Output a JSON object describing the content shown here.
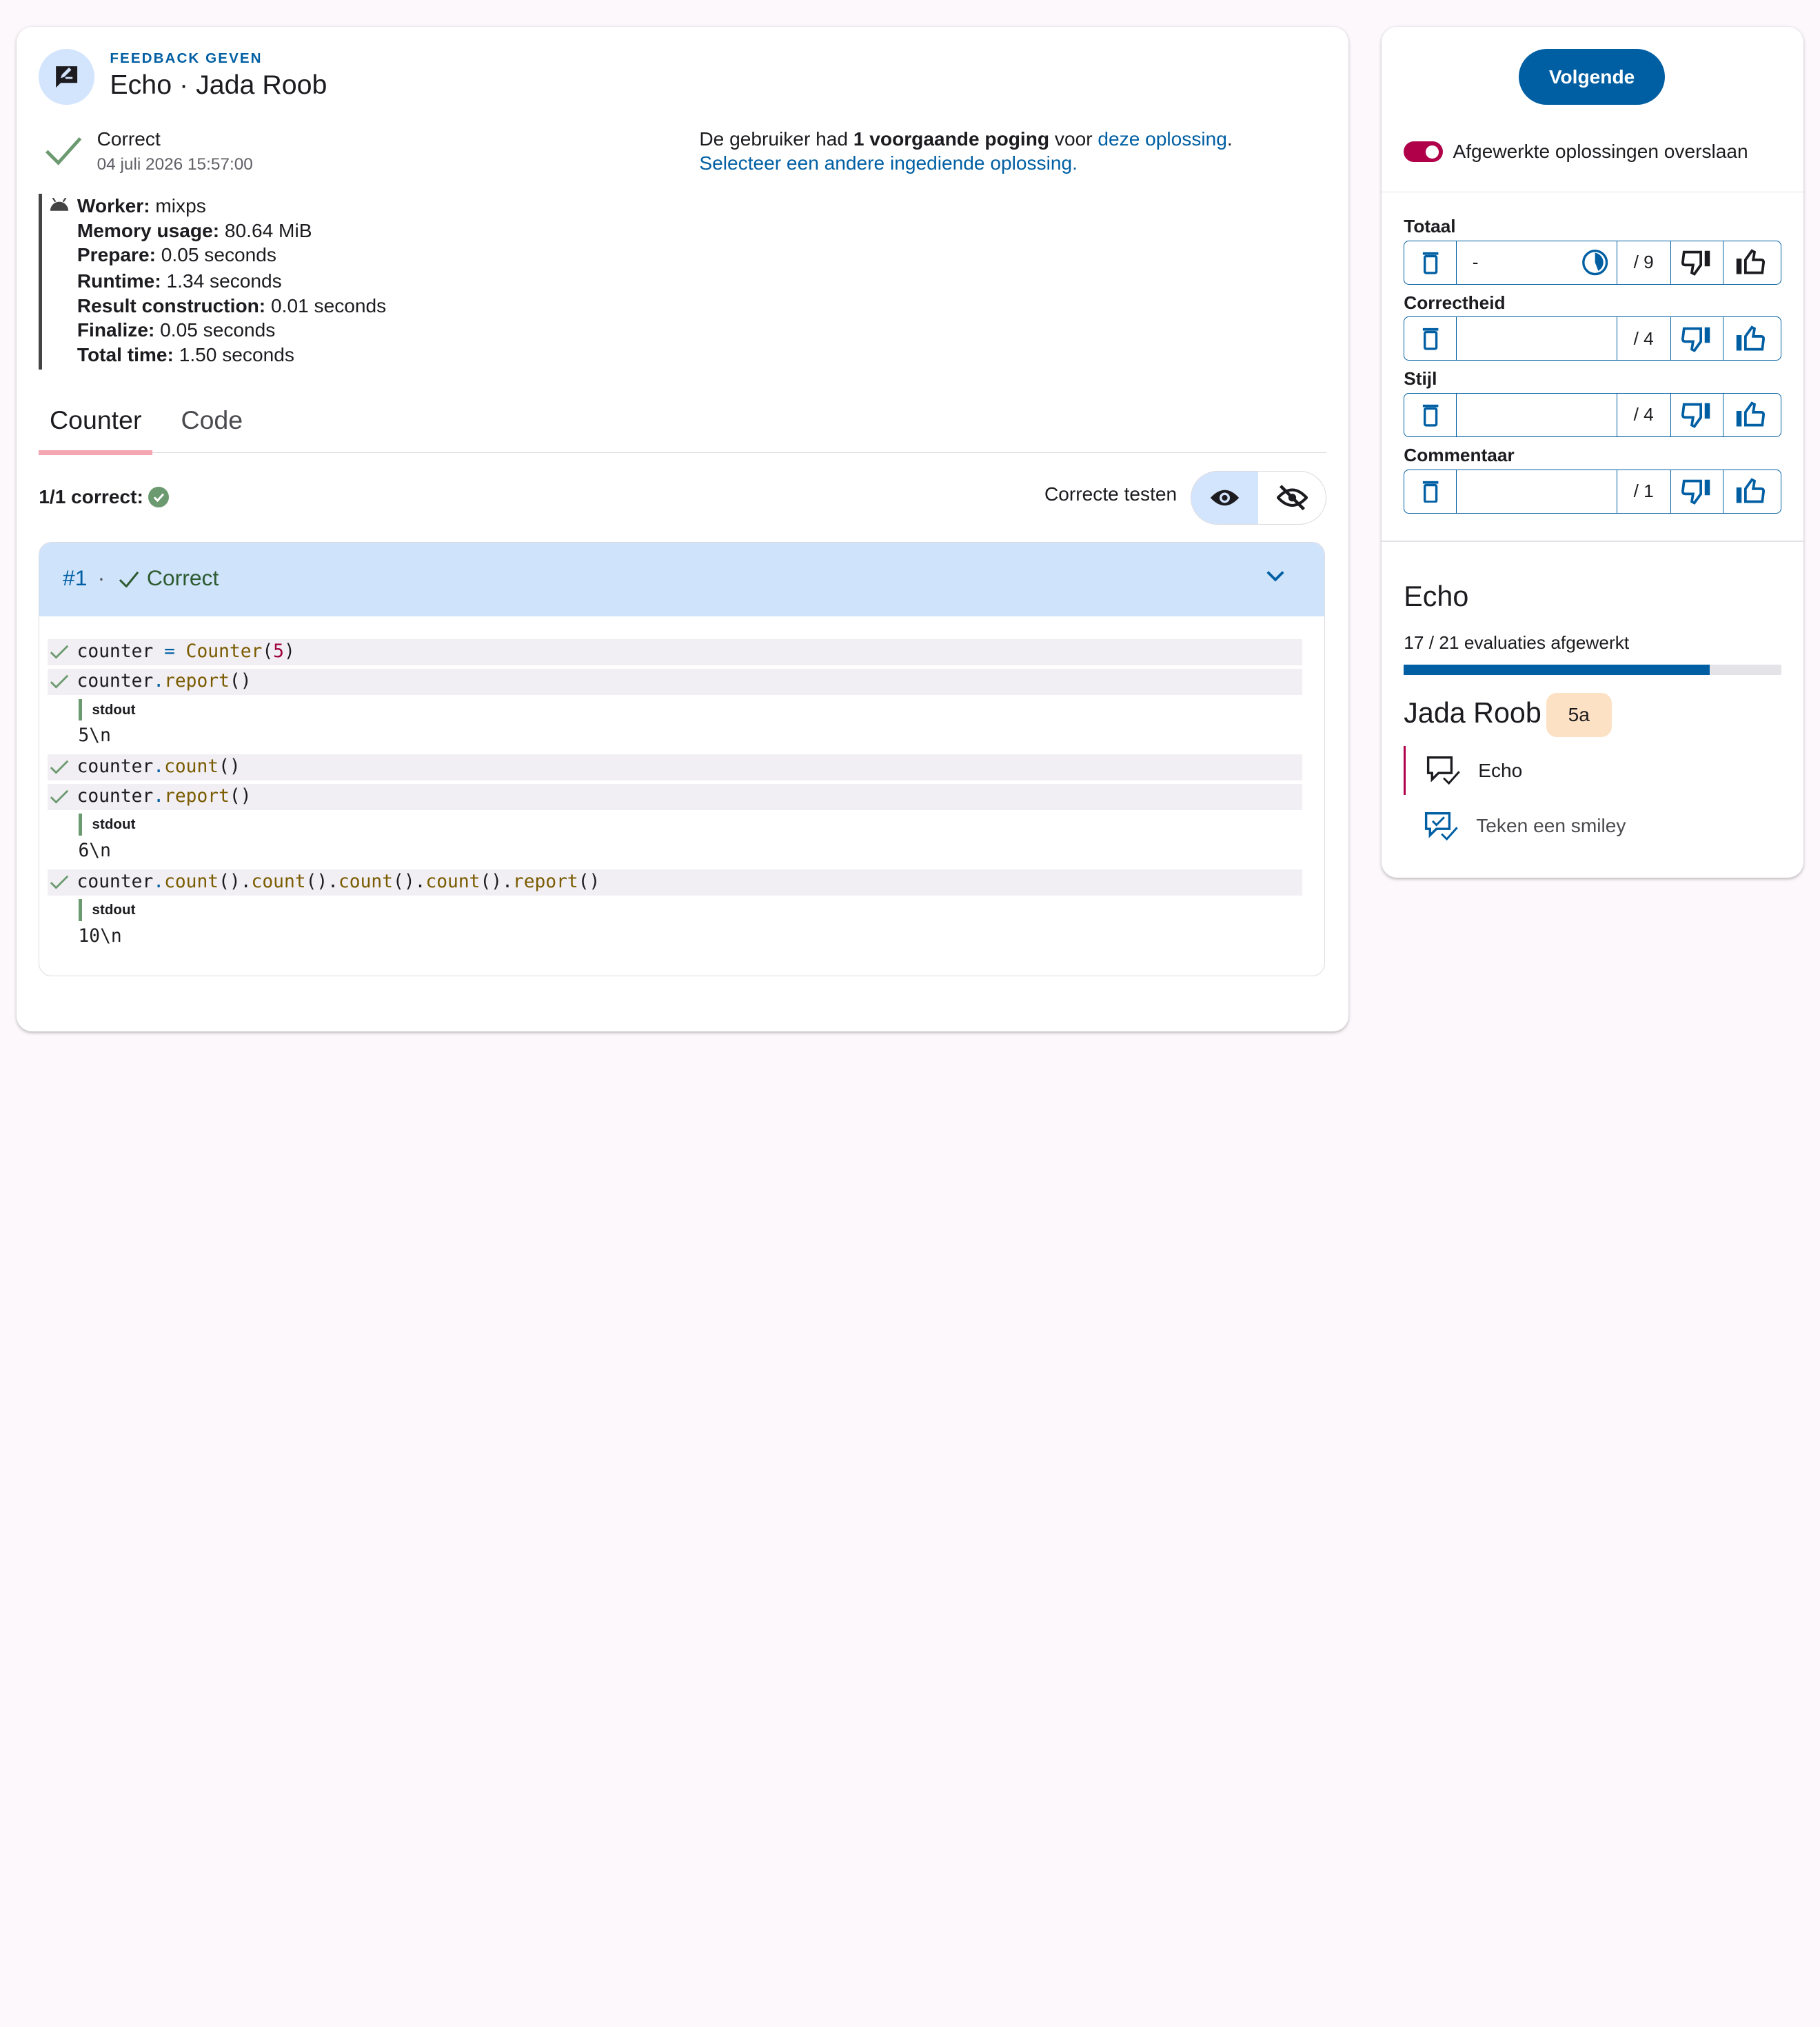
{
  "header": {
    "kicker": "FEEDBACK GEVEN",
    "title": "Echo · Jada Roob",
    "icon": "rate-review-icon"
  },
  "status": {
    "label": "Correct",
    "date": "04 juli 2026 15:57:00"
  },
  "previous": {
    "text_before": "De gebruiker had ",
    "bold": "1 voorgaande poging",
    "text_mid": " voor ",
    "link1": "deze oplossing",
    "text_end": ".",
    "link2": "Selecteer een andere ingediende oplossing."
  },
  "worker": [
    {
      "label": "Worker:",
      "value": " mixps"
    },
    {
      "label": "Memory usage:",
      "value": " 80.64 MiB"
    },
    {
      "label": "Prepare:",
      "value": " 0.05 seconds"
    },
    {
      "label": "Runtime:",
      "value": " 1.34 seconds"
    },
    {
      "label": "Result construction:",
      "value": " 0.01 seconds"
    },
    {
      "label": "Finalize:",
      "value": " 0.05 seconds"
    },
    {
      "label": "Total time:",
      "value": " 1.50 seconds"
    }
  ],
  "tabs": [
    "Counter",
    "Code"
  ],
  "summary": {
    "text": "1/1 correct:",
    "correct_tests_label": "Correcte testen"
  },
  "testcase": {
    "number": "#1",
    "separator": "·",
    "result": "Correct",
    "lines": [
      {
        "code": [
          "counter ",
          "= ",
          "Counter",
          "(",
          "5",
          ")"
        ]
      },
      {
        "code": [
          "counter",
          ".",
          "report",
          "()"
        ]
      },
      {
        "output_tag": "stdout",
        "output": "5\\n"
      },
      {
        "code": [
          "counter",
          ".",
          "count",
          "()"
        ]
      },
      {
        "code": [
          "counter",
          ".",
          "report",
          "()"
        ]
      },
      {
        "output_tag": "stdout",
        "output": "6\\n"
      },
      {
        "code": [
          "counter",
          ".",
          "count",
          "().",
          "count",
          "().",
          "count",
          "().",
          "count",
          "().",
          "report",
          "()"
        ]
      },
      {
        "output_tag": "stdout",
        "output": "10\\n"
      }
    ],
    "stdout_label": "stdout",
    "out1": "5\\n",
    "out2": "6\\n",
    "out3": "10\\n"
  },
  "sidebar": {
    "next_label": "Volgende",
    "skip_label": "Afgewerkte oplossingen overslaan",
    "scores": [
      {
        "label": "Totaal",
        "value": "-",
        "max": "/ 9"
      },
      {
        "label": "Correctheid",
        "value": "",
        "max": "/ 4"
      },
      {
        "label": "Stijl",
        "value": "",
        "max": "/ 4"
      },
      {
        "label": "Commentaar",
        "value": "",
        "max": "/ 1"
      }
    ],
    "exercise_title": "Echo",
    "progress_text": "17 / 21 evaluaties afgewerkt",
    "progress_fraction": 0.81,
    "user_name": "Jada Roob",
    "user_badge": "5a",
    "items": [
      {
        "label": "Echo"
      },
      {
        "label": "Teken een smiley"
      }
    ]
  },
  "colors": {
    "primary": "#005fa3",
    "accent": "#b0004a",
    "success": "#6b9a70"
  }
}
